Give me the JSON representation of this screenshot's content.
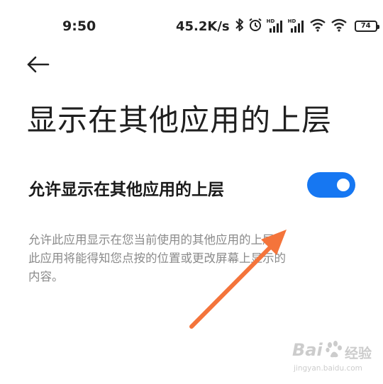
{
  "status_bar": {
    "time": "9:50",
    "net_speed": "45.2K/s",
    "hd_label": "HD",
    "battery": "74",
    "icons": [
      "bluetooth-icon",
      "alarm-icon",
      "hd-signal-icon",
      "hd-signal-icon",
      "wifi-icon",
      "wifi-icon",
      "battery-icon"
    ]
  },
  "header": {
    "back_icon": "back-arrow-icon",
    "title": "显示在其他应用的上层"
  },
  "setting": {
    "label": "允许显示在其他应用的上层",
    "toggle_on": true,
    "toggle_color": "#1677f2"
  },
  "description": {
    "lines": [
      "允许此应用显示在您当前使用的其他应用的上层。",
      "此应用将能得知您点按的位置或更改屏幕上显示的",
      "内容。"
    ]
  },
  "annotation": {
    "arrow_color": "#f4743b"
  },
  "watermark": {
    "brand": "Bai",
    "brand_suffix": "经验",
    "url": "jingyan.baidu.com"
  }
}
